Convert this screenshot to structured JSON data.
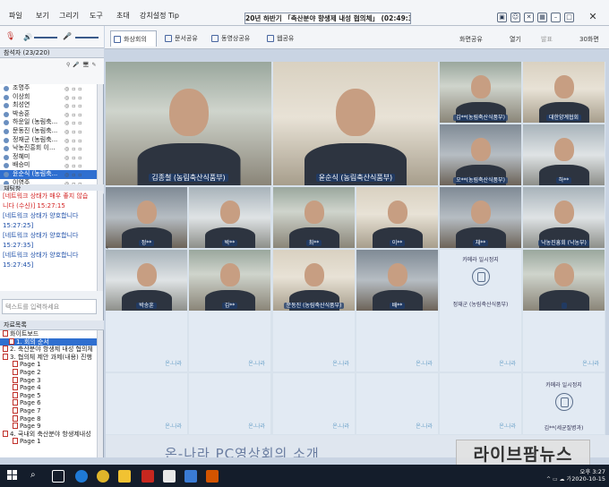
{
  "menu": [
    "파일",
    "보기",
    "그리기",
    "도구",
    "초대",
    "강치설정 Tip"
  ],
  "conference_title": "20년 하반기 「축산분야 향생제 내성 협의체」 (02:49:35)",
  "participants": {
    "header": "참석자 (23/220)",
    "list": [
      "조명주",
      "이상희",
      "최성연",
      "박송훈",
      "하운일 (농림축...",
      "문동진 (농림축...",
      "정재군 (농림축...",
      "낙농진흥회 이...",
      "정혜미",
      "배승미",
      "윤순식 (농림축...",
      "이영주",
      "대한양계협회"
    ],
    "selected_index": 10
  },
  "chat": {
    "header": "채팅창",
    "messages": [
      {
        "text": "[네트워크 상태가 매우 좋지 않습",
        "color": "red"
      },
      {
        "text": "니다 (수신)] 15:27:15",
        "color": "red"
      },
      {
        "text": "[네트워크 상태가 양호합니다",
        "color": "blue"
      },
      {
        "text": "15:27:25]",
        "color": "blue"
      },
      {
        "text": "[네트워크 상태가 양호합니다",
        "color": "blue"
      },
      {
        "text": "15:27:35]",
        "color": "blue"
      },
      {
        "text": "[네트워크 상태가 양호합니다",
        "color": "blue"
      },
      {
        "text": "15:27:45]",
        "color": "blue"
      }
    ],
    "input_placeholder": "텍스트를 입력하세요"
  },
  "documents": {
    "header": "자료목록",
    "items": [
      "화이트보드",
      "1. 회의 순서",
      "2. 축산분야 항생제 내성 협의체",
      "3. 협의체 제안 과제(내용) 진행",
      "Page 1",
      "Page 2",
      "Page 3",
      "Page 4",
      "Page 5",
      "Page 6",
      "Page 7",
      "Page 8",
      "Page 9",
      "4. 국내외 축산분야 항생제내성",
      "Page 1"
    ]
  },
  "tabs": [
    "화상회의",
    "문서공유",
    "동영상공유",
    "웹공유"
  ],
  "tab_actions": [
    "화면공유",
    "열기",
    "발표",
    "30화면"
  ],
  "video": {
    "big": [
      "김종철 (농림축산식품부)",
      "윤순식 (농림축산식품부)"
    ],
    "small": [
      "김**(농림축산식품부)",
      "대한양계협회",
      "오**(농림축산식품부)",
      "하**",
      "정**",
      "박**",
      "최**",
      "이**",
      "채**",
      "낙농진흥회 (낙농부)",
      "박송훈",
      "김**",
      "문동진 (농림축산식품부)",
      "배**",
      "",
      "이**"
    ],
    "stopped_label": "카메라 일시정지",
    "stopped_names": [
      "정재군 (농림축산식품부)",
      "김**(세균질병과)"
    ],
    "empty_logo": "온-나라"
  },
  "slide_text": "온-나라 PC영상회의 소개",
  "watermark": "라이브팜뉴스",
  "clock": {
    "time": "오후 3:27",
    "date": "2020-10-15"
  },
  "colors": {
    "accent": "#2f6fd0",
    "warning": "#d21f1f",
    "ok": "#1e4fa8"
  }
}
